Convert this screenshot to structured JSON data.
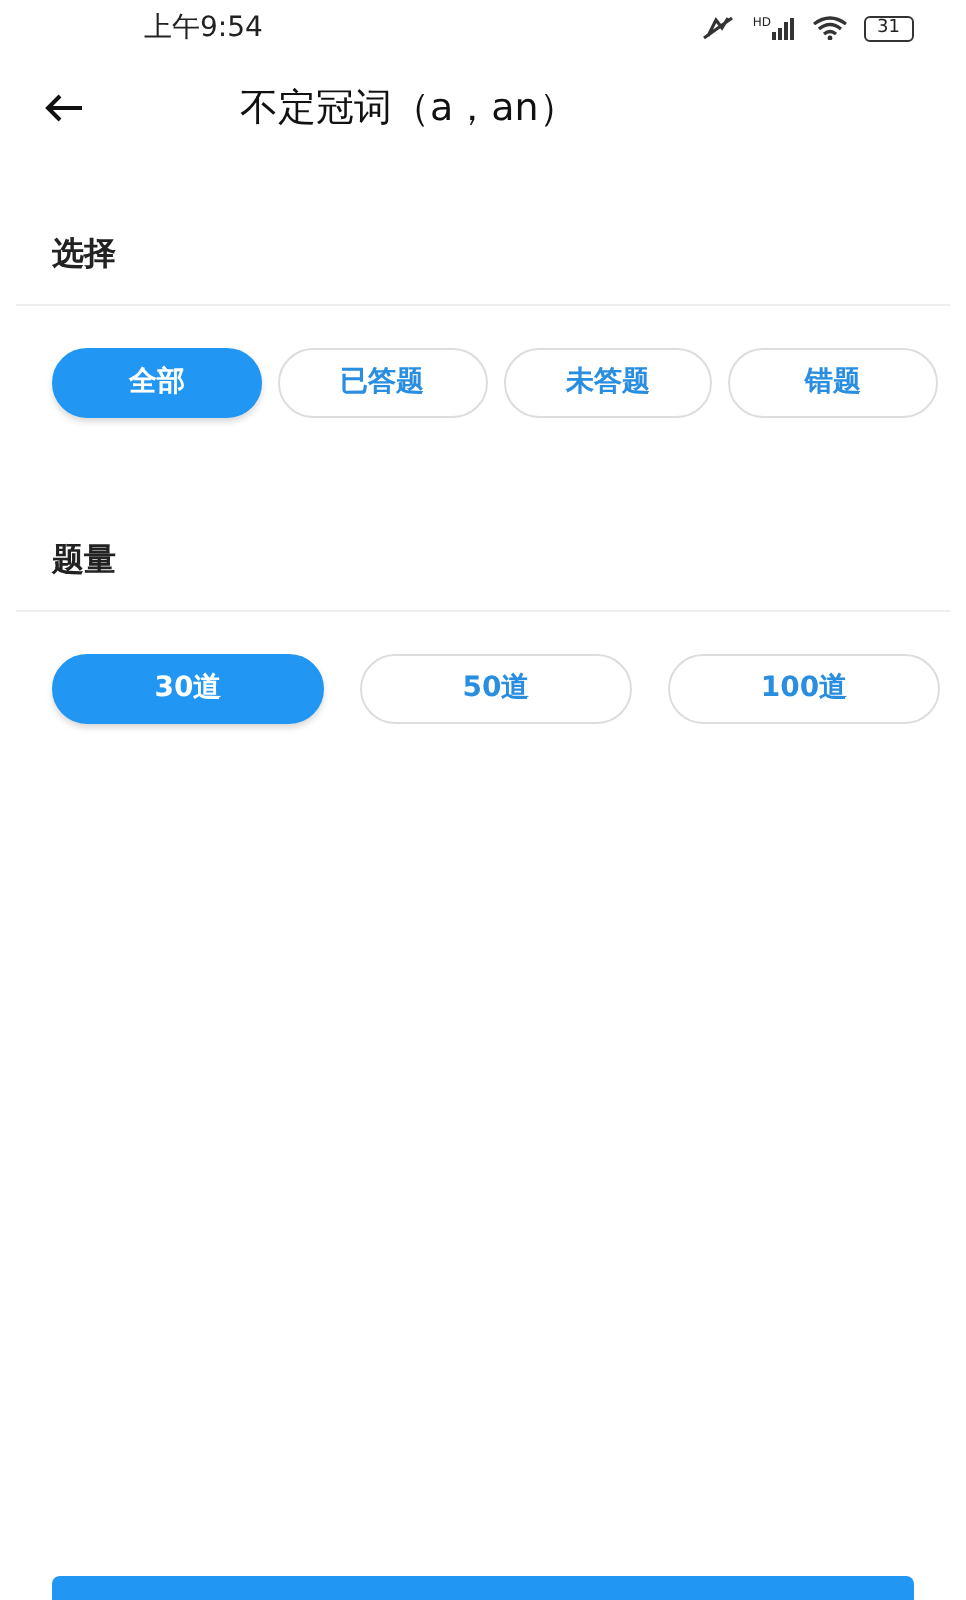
{
  "status_bar": {
    "time": "上午9:54",
    "signal_label": "HD",
    "battery": "31"
  },
  "header": {
    "title": "不定冠词（a，an）"
  },
  "sections": [
    {
      "title": "选择",
      "options": [
        {
          "label": "全部",
          "selected": true
        },
        {
          "label": "已答题",
          "selected": false
        },
        {
          "label": "未答题",
          "selected": false
        },
        {
          "label": "错题",
          "selected": false
        }
      ]
    },
    {
      "title": "题量",
      "options": [
        {
          "label": "30道",
          "selected": true
        },
        {
          "label": "50道",
          "selected": false
        },
        {
          "label": "100道",
          "selected": false
        }
      ]
    }
  ]
}
